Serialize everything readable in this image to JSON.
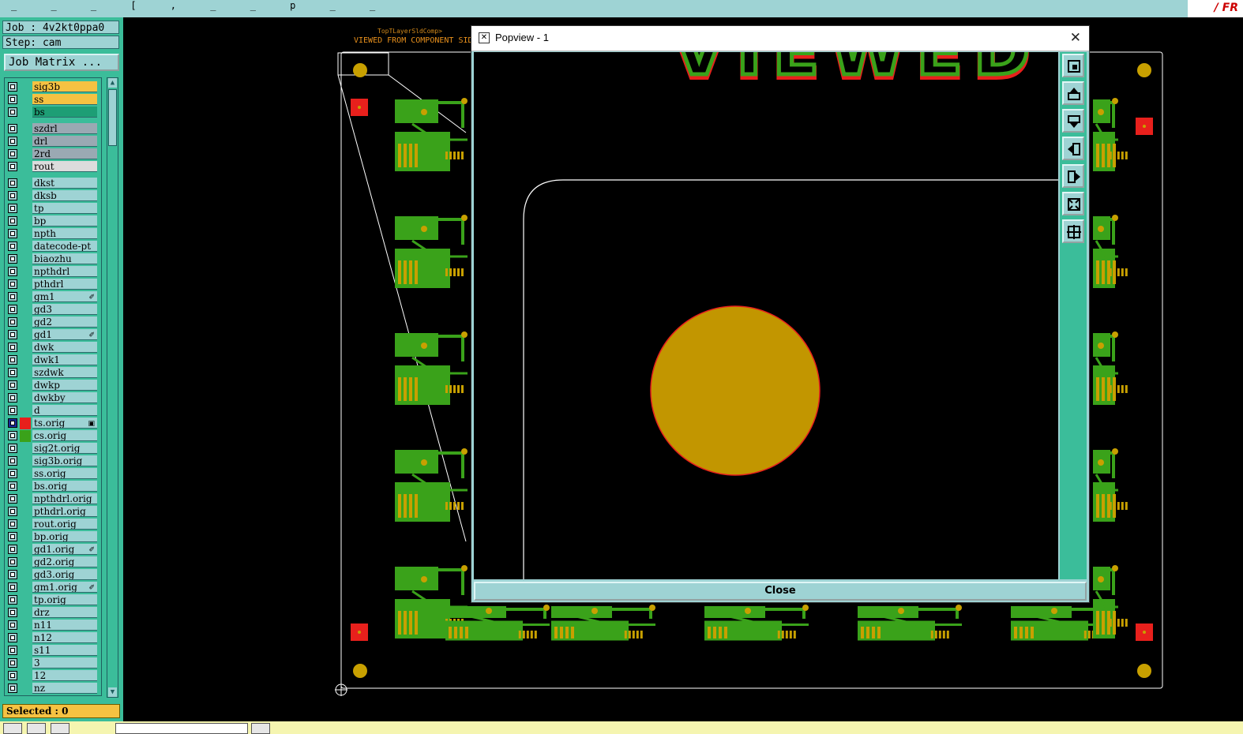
{
  "topbar": {
    "deco": "_  _  _  [  ,  _  _ p _  _"
  },
  "left_panel": {
    "job_label": "Job : 4v2kt0ppa0",
    "step_label": "Step: cam",
    "job_matrix_button": "Job Matrix ...",
    "selected_label": "Selected : 0"
  },
  "layers": [
    {
      "name": "sig3b",
      "color": "#f5c242"
    },
    {
      "name": "ss",
      "color": "#f5c242"
    },
    {
      "name": "bs",
      "color": "#1d9e75"
    },
    {
      "name": "szdrl",
      "color": "#9aa9b3"
    },
    {
      "name": "drl",
      "color": "#9aa9b3"
    },
    {
      "name": "2rd",
      "color": "#9aa9b3"
    },
    {
      "name": "rout",
      "color": "#dcdcdc"
    },
    {
      "name": "dkst",
      "color": "#9ed3d4"
    },
    {
      "name": "dksb",
      "color": "#9ed3d4"
    },
    {
      "name": "tp",
      "color": "#9ed3d4"
    },
    {
      "name": "bp",
      "color": "#9ed3d4"
    },
    {
      "name": "npth",
      "color": "#9ed3d4"
    },
    {
      "name": "datecode-pt",
      "color": "#9ed3d4"
    },
    {
      "name": "biaozhu",
      "color": "#9ed3d4"
    },
    {
      "name": "npthdrl",
      "color": "#9ed3d4"
    },
    {
      "name": "pthdrl",
      "color": "#9ed3d4"
    },
    {
      "name": "gm1",
      "color": "#9ed3d4",
      "mark": "✐"
    },
    {
      "name": "gd3",
      "color": "#9ed3d4"
    },
    {
      "name": "gd2",
      "color": "#9ed3d4"
    },
    {
      "name": "gd1",
      "color": "#9ed3d4",
      "mark": "✐"
    },
    {
      "name": "dwk",
      "color": "#9ed3d4"
    },
    {
      "name": "dwk1",
      "color": "#9ed3d4"
    },
    {
      "name": "szdwk",
      "color": "#9ed3d4"
    },
    {
      "name": "dwkp",
      "color": "#9ed3d4"
    },
    {
      "name": "dwkby",
      "color": "#9ed3d4"
    },
    {
      "name": "d",
      "color": "#9ed3d4"
    },
    {
      "name": "ts.orig",
      "color": "#9ed3d4",
      "swatch": "#e8201c",
      "active": true,
      "mark": "▣"
    },
    {
      "name": "cs.orig",
      "color": "#9ed3d4",
      "swatch": "#3aa21a"
    },
    {
      "name": "sig2t.orig",
      "color": "#9ed3d4"
    },
    {
      "name": "sig3b.orig",
      "color": "#9ed3d4"
    },
    {
      "name": "ss.orig",
      "color": "#9ed3d4"
    },
    {
      "name": "bs.orig",
      "color": "#9ed3d4"
    },
    {
      "name": "npthdrl.orig",
      "color": "#9ed3d4"
    },
    {
      "name": "pthdrl.orig",
      "color": "#9ed3d4"
    },
    {
      "name": "rout.orig",
      "color": "#9ed3d4"
    },
    {
      "name": "bp.orig",
      "color": "#9ed3d4"
    },
    {
      "name": "gd1.orig",
      "color": "#9ed3d4",
      "mark": "✐"
    },
    {
      "name": "gd2.orig",
      "color": "#9ed3d4"
    },
    {
      "name": "gd3.orig",
      "color": "#9ed3d4"
    },
    {
      "name": "gm1.orig",
      "color": "#9ed3d4",
      "mark": "✐"
    },
    {
      "name": "tp.orig",
      "color": "#9ed3d4"
    },
    {
      "name": "drz",
      "color": "#9ed3d4"
    },
    {
      "name": "n11",
      "color": "#9ed3d4"
    },
    {
      "name": "n12",
      "color": "#9ed3d4"
    },
    {
      "name": "s11",
      "color": "#9ed3d4"
    },
    {
      "name": "3",
      "color": "#9ed3d4"
    },
    {
      "name": "12",
      "color": "#9ed3d4"
    },
    {
      "name": "nz",
      "color": "#9ed3d4"
    }
  ],
  "canvas": {
    "top_label": "TopTLayerSldComp>",
    "viewed_label": "VIEWED FROM COMPONENT SIDE",
    "colors": {
      "copper": "#3aa21a",
      "pad": "#c8a000",
      "fiducial": "#e8201c",
      "outline": "#ffffff"
    }
  },
  "popview": {
    "title": "Popview - 1",
    "close_button": "Close",
    "big_text": "VIEWED F",
    "tools": [
      "zoom-fit-icon",
      "pan-up-icon",
      "pan-down-icon",
      "pan-left-icon",
      "pan-right-icon",
      "zoom-out-icon",
      "zoom-in-icon"
    ],
    "pad_color": "#c29600",
    "pad_edge_color": "#e8201c"
  }
}
